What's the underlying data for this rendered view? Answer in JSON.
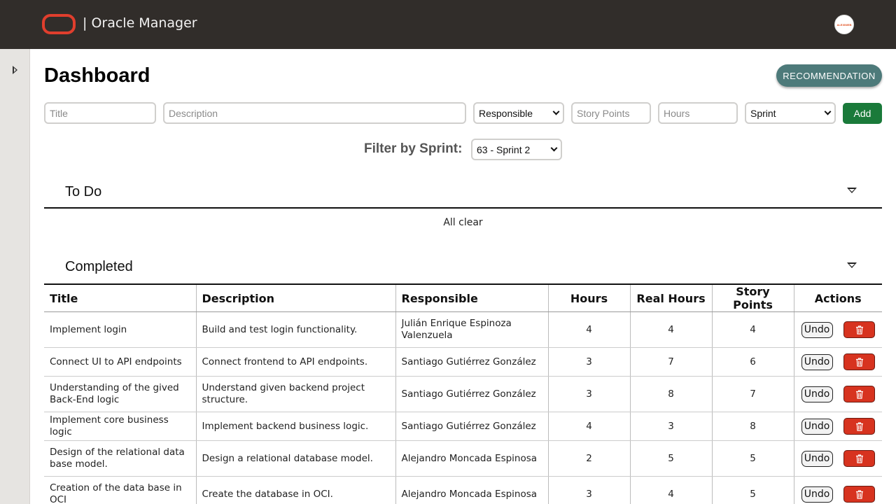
{
  "header": {
    "app_title": "| Oracle Manager",
    "logo_icon": "oracle-logo-icon",
    "avatar_text": "ALEXIWEB"
  },
  "sidebar": {
    "toggle_icon": "caret-right-icon"
  },
  "page": {
    "title": "Dashboard",
    "recommendation_label": "RECOMMENDATION"
  },
  "form": {
    "title_placeholder": "Title",
    "description_placeholder": "Description",
    "responsible_value": "Responsible",
    "story_points_placeholder": "Story Points",
    "hours_placeholder": "Hours",
    "sprint_value": "Sprint",
    "add_label": "Add"
  },
  "filter": {
    "label": "Filter by Sprint:",
    "value": "63 - Sprint 2"
  },
  "todo": {
    "title": "To Do",
    "empty_text": "All clear"
  },
  "completed": {
    "title": "Completed",
    "columns": [
      "Title",
      "Description",
      "Responsible",
      "Hours",
      "Real Hours",
      "Story Points",
      "Actions"
    ],
    "undo_label": "Undo",
    "rows": [
      {
        "title": "Implement login",
        "description": "Build and test login functionality.",
        "responsible": "Julián Enrique Espinoza Valenzuela",
        "hours": "4",
        "real_hours": "4",
        "story_points": "4"
      },
      {
        "title": "Connect UI to API endpoints",
        "description": "Connect frontend to API endpoints.",
        "responsible": "Santiago Gutiérrez González",
        "hours": "3",
        "real_hours": "7",
        "story_points": "6"
      },
      {
        "title": "Understanding of the gived Back-End logic",
        "description": "Understand given backend project structure.",
        "responsible": "Santiago Gutiérrez González",
        "hours": "3",
        "real_hours": "8",
        "story_points": "7"
      },
      {
        "title": "Implement core business logic",
        "description": "Implement backend business logic.",
        "responsible": "Santiago Gutiérrez González",
        "hours": "4",
        "real_hours": "3",
        "story_points": "8"
      },
      {
        "title": "Design of the relational data base model.",
        "description": "Design a relational database model.",
        "responsible": "Alejandro Moncada Espinosa",
        "hours": "2",
        "real_hours": "5",
        "story_points": "5"
      },
      {
        "title": "Creation of the data base in OCI",
        "description": "Create the database in OCI.",
        "responsible": "Alejandro Moncada Espinosa",
        "hours": "3",
        "real_hours": "4",
        "story_points": "5"
      }
    ]
  },
  "colors": {
    "topbar": "#312d2a",
    "accent_red": "#e03e2d",
    "recommendation": "#4d7a7a",
    "add_green": "#1a7a3a",
    "delete_red": "#d7331f"
  }
}
